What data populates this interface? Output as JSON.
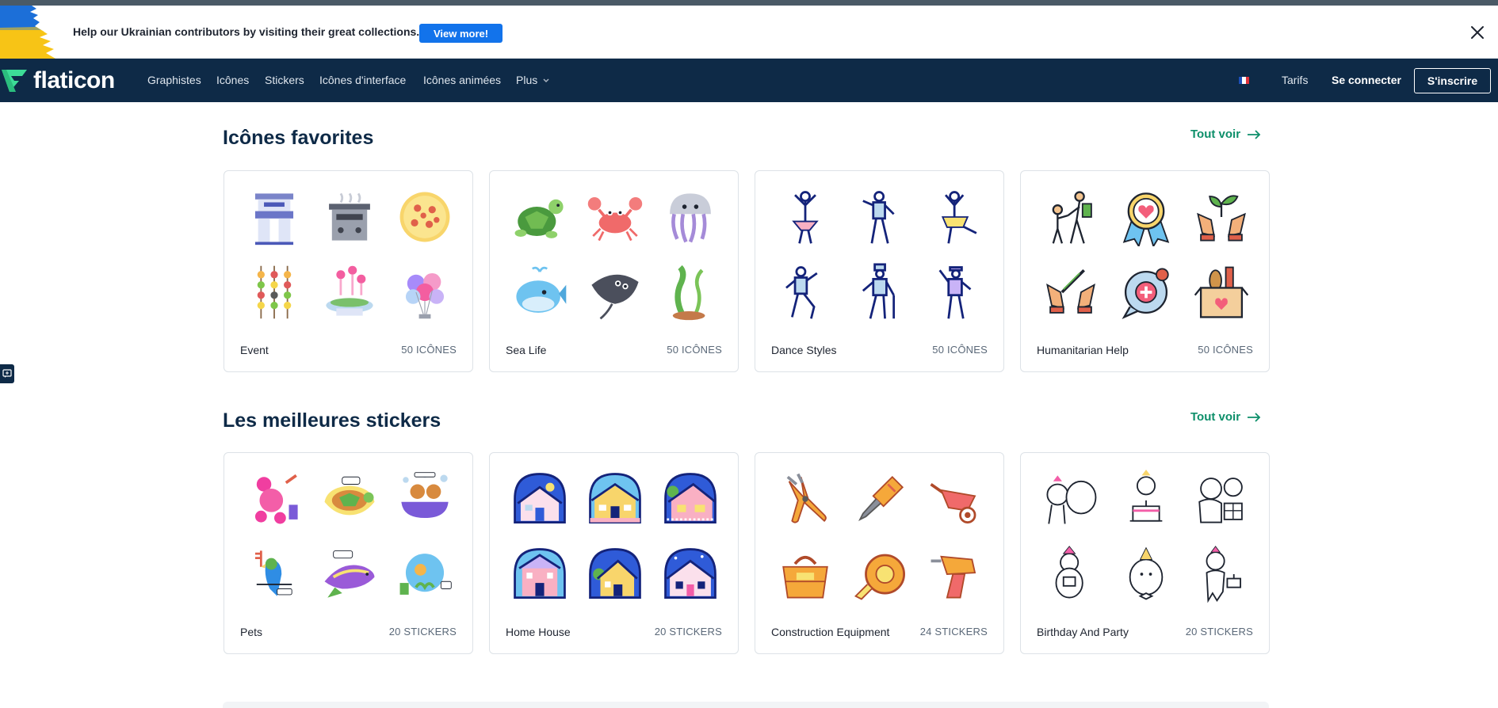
{
  "banner": {
    "text": "Help our Ukrainian contributors by visiting their great collections.",
    "button_label": "View more!",
    "colors": {
      "blue": "#1273eb",
      "flag_blue": "#1c6fd8",
      "flag_yellow": "#f7c416"
    }
  },
  "nav": {
    "logo_text": "flaticon",
    "links": [
      "Graphistes",
      "Icônes",
      "Stickers",
      "Icônes d'interface",
      "Icônes animées",
      "Plus"
    ],
    "pricing": "Tarifs",
    "login": "Se connecter",
    "signup": "S'inscrire",
    "background": "#0e2a47",
    "accent": "#3ddc97"
  },
  "sections": [
    {
      "title": "Icônes favorites",
      "see_all": "Tout voir",
      "cards": [
        {
          "name": "Event",
          "count": "50 ICÔNES",
          "icons": [
            "kiosk-icon",
            "grill-icon",
            "pizza-icon",
            "skewers-icon",
            "fountain-icon",
            "balloons-icon"
          ]
        },
        {
          "name": "Sea Life",
          "count": "50 ICÔNES",
          "icons": [
            "turtle-icon",
            "crab-icon",
            "jellyfish-icon",
            "whale-icon",
            "stingray-icon",
            "seaweed-icon"
          ]
        },
        {
          "name": "Dance Styles",
          "count": "50 ICÔNES",
          "icons": [
            "ballerina-icon",
            "dancer-icon",
            "dancer-skirt-icon",
            "dancer-2-icon",
            "tap-dancer-icon",
            "dancer-cap-icon"
          ]
        },
        {
          "name": "Humanitarian Help",
          "count": "50 ICÔNES",
          "icons": [
            "volunteers-icon",
            "heart-badge-icon",
            "plant-hands-icon",
            "vaccine-hands-icon",
            "medical-chat-icon",
            "donation-box-icon"
          ]
        }
      ]
    },
    {
      "title": "Les meilleures stickers",
      "see_all": "Tout voir",
      "cards": [
        {
          "name": "Pets",
          "count": "20 STICKERS",
          "icons": [
            "poodle-sticker",
            "turtle-sticker",
            "bath-dogs-sticker",
            "parrot-sticker",
            "fish-sticker",
            "aquarium-sticker"
          ]
        },
        {
          "name": "Home House",
          "count": "20 STICKERS",
          "icons": [
            "house-1-sticker",
            "house-2-sticker",
            "house-3-sticker",
            "house-4-sticker",
            "house-5-sticker",
            "house-6-sticker"
          ]
        },
        {
          "name": "Construction Equipment",
          "count": "24 STICKERS",
          "icons": [
            "pliers-sticker",
            "screwdriver-sticker",
            "wheelbarrow-sticker",
            "tool-bag-sticker",
            "tape-measure-sticker",
            "drill-sticker"
          ]
        },
        {
          "name": "Birthday And Party",
          "count": "20 STICKERS",
          "icons": [
            "birthday-balloon-sticker",
            "birthday-cake-sticker",
            "birthday-gift-sticker",
            "birthday-party-sticker",
            "birthday-bowtie-sticker",
            "birthday-cupcake-sticker"
          ]
        }
      ]
    }
  ]
}
